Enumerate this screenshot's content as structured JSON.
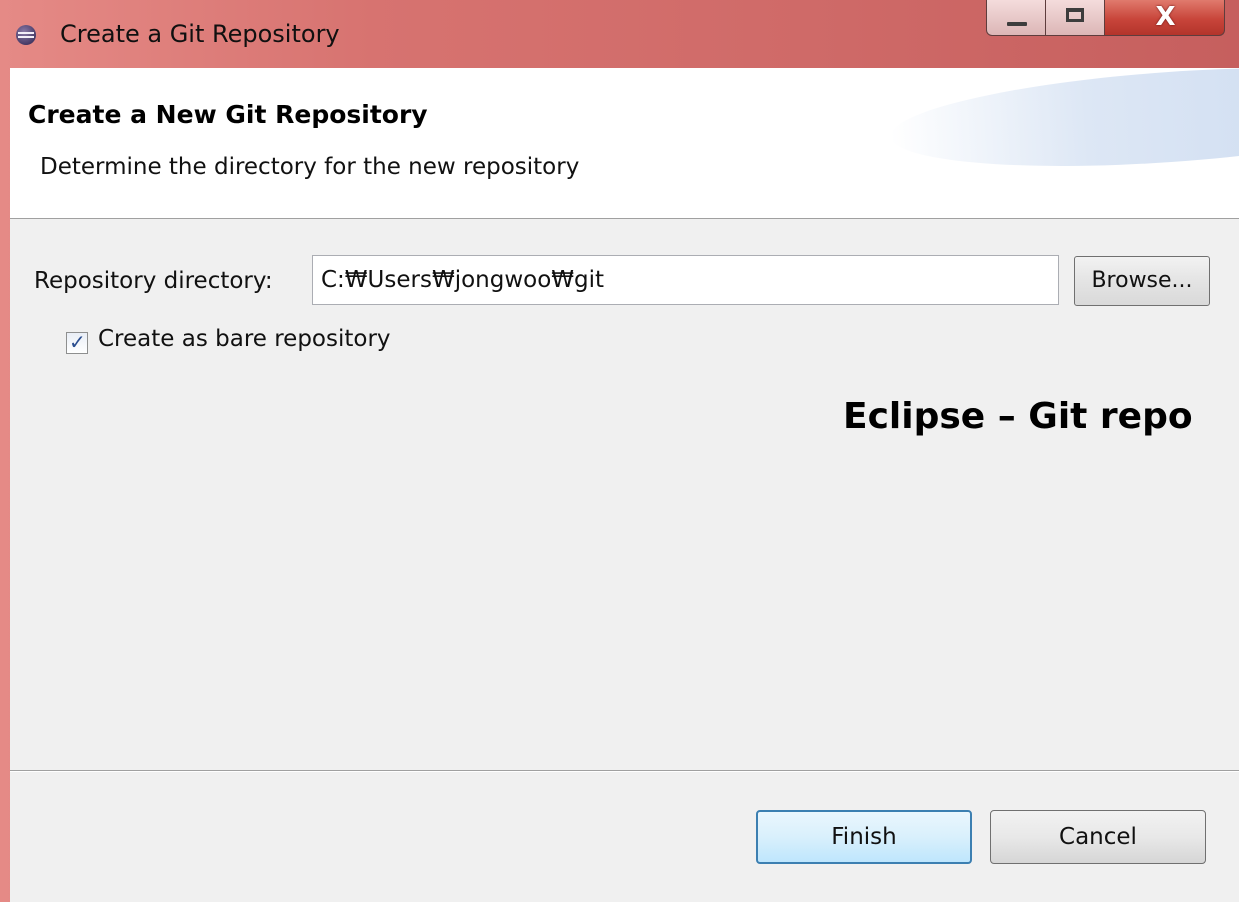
{
  "window": {
    "title": "Create a Git Repository",
    "close_glyph": "X",
    "colors": {
      "title_bar": "#d77370",
      "close_button": "#c8453a",
      "client_bg": "#f0f0f0"
    }
  },
  "header": {
    "title": "Create a New Git Repository",
    "description": "Determine the directory for the new repository"
  },
  "form": {
    "directory_label": "Repository directory:",
    "directory_value": "C:₩Users₩jongwoo₩git",
    "browse_label": "Browse...",
    "bare_checkbox_label": "Create as bare repository",
    "bare_checked": true
  },
  "overlay": {
    "caption": "Eclipse – Git repo"
  },
  "footer": {
    "finish_label": "Finish",
    "cancel_label": "Cancel"
  },
  "icons": {
    "app": "eclipse-icon",
    "minimize": "minimize-icon",
    "maximize": "maximize-icon",
    "close": "close-icon",
    "check": "checkmark-icon"
  }
}
